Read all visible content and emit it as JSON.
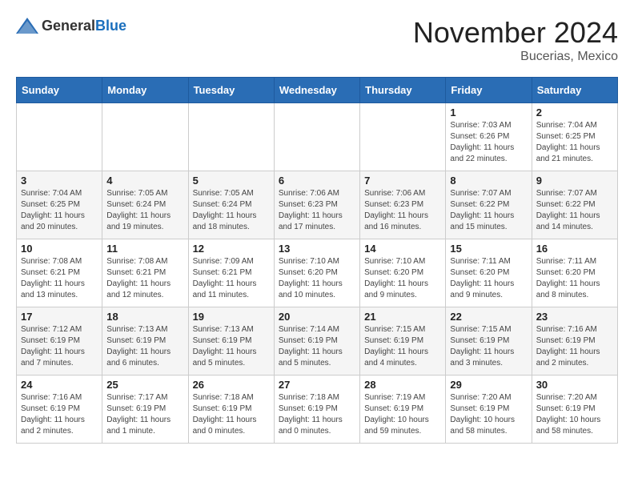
{
  "logo": {
    "text_general": "General",
    "text_blue": "Blue"
  },
  "title": "November 2024",
  "subtitle": "Bucerias, Mexico",
  "days_of_week": [
    "Sunday",
    "Monday",
    "Tuesday",
    "Wednesday",
    "Thursday",
    "Friday",
    "Saturday"
  ],
  "weeks": [
    [
      {
        "day": "",
        "info": ""
      },
      {
        "day": "",
        "info": ""
      },
      {
        "day": "",
        "info": ""
      },
      {
        "day": "",
        "info": ""
      },
      {
        "day": "",
        "info": ""
      },
      {
        "day": "1",
        "info": "Sunrise: 7:03 AM\nSunset: 6:26 PM\nDaylight: 11 hours\nand 22 minutes."
      },
      {
        "day": "2",
        "info": "Sunrise: 7:04 AM\nSunset: 6:25 PM\nDaylight: 11 hours\nand 21 minutes."
      }
    ],
    [
      {
        "day": "3",
        "info": "Sunrise: 7:04 AM\nSunset: 6:25 PM\nDaylight: 11 hours\nand 20 minutes."
      },
      {
        "day": "4",
        "info": "Sunrise: 7:05 AM\nSunset: 6:24 PM\nDaylight: 11 hours\nand 19 minutes."
      },
      {
        "day": "5",
        "info": "Sunrise: 7:05 AM\nSunset: 6:24 PM\nDaylight: 11 hours\nand 18 minutes."
      },
      {
        "day": "6",
        "info": "Sunrise: 7:06 AM\nSunset: 6:23 PM\nDaylight: 11 hours\nand 17 minutes."
      },
      {
        "day": "7",
        "info": "Sunrise: 7:06 AM\nSunset: 6:23 PM\nDaylight: 11 hours\nand 16 minutes."
      },
      {
        "day": "8",
        "info": "Sunrise: 7:07 AM\nSunset: 6:22 PM\nDaylight: 11 hours\nand 15 minutes."
      },
      {
        "day": "9",
        "info": "Sunrise: 7:07 AM\nSunset: 6:22 PM\nDaylight: 11 hours\nand 14 minutes."
      }
    ],
    [
      {
        "day": "10",
        "info": "Sunrise: 7:08 AM\nSunset: 6:21 PM\nDaylight: 11 hours\nand 13 minutes."
      },
      {
        "day": "11",
        "info": "Sunrise: 7:08 AM\nSunset: 6:21 PM\nDaylight: 11 hours\nand 12 minutes."
      },
      {
        "day": "12",
        "info": "Sunrise: 7:09 AM\nSunset: 6:21 PM\nDaylight: 11 hours\nand 11 minutes."
      },
      {
        "day": "13",
        "info": "Sunrise: 7:10 AM\nSunset: 6:20 PM\nDaylight: 11 hours\nand 10 minutes."
      },
      {
        "day": "14",
        "info": "Sunrise: 7:10 AM\nSunset: 6:20 PM\nDaylight: 11 hours\nand 9 minutes."
      },
      {
        "day": "15",
        "info": "Sunrise: 7:11 AM\nSunset: 6:20 PM\nDaylight: 11 hours\nand 9 minutes."
      },
      {
        "day": "16",
        "info": "Sunrise: 7:11 AM\nSunset: 6:20 PM\nDaylight: 11 hours\nand 8 minutes."
      }
    ],
    [
      {
        "day": "17",
        "info": "Sunrise: 7:12 AM\nSunset: 6:19 PM\nDaylight: 11 hours\nand 7 minutes."
      },
      {
        "day": "18",
        "info": "Sunrise: 7:13 AM\nSunset: 6:19 PM\nDaylight: 11 hours\nand 6 minutes."
      },
      {
        "day": "19",
        "info": "Sunrise: 7:13 AM\nSunset: 6:19 PM\nDaylight: 11 hours\nand 5 minutes."
      },
      {
        "day": "20",
        "info": "Sunrise: 7:14 AM\nSunset: 6:19 PM\nDaylight: 11 hours\nand 5 minutes."
      },
      {
        "day": "21",
        "info": "Sunrise: 7:15 AM\nSunset: 6:19 PM\nDaylight: 11 hours\nand 4 minutes."
      },
      {
        "day": "22",
        "info": "Sunrise: 7:15 AM\nSunset: 6:19 PM\nDaylight: 11 hours\nand 3 minutes."
      },
      {
        "day": "23",
        "info": "Sunrise: 7:16 AM\nSunset: 6:19 PM\nDaylight: 11 hours\nand 2 minutes."
      }
    ],
    [
      {
        "day": "24",
        "info": "Sunrise: 7:16 AM\nSunset: 6:19 PM\nDaylight: 11 hours\nand 2 minutes."
      },
      {
        "day": "25",
        "info": "Sunrise: 7:17 AM\nSunset: 6:19 PM\nDaylight: 11 hours\nand 1 minute."
      },
      {
        "day": "26",
        "info": "Sunrise: 7:18 AM\nSunset: 6:19 PM\nDaylight: 11 hours\nand 0 minutes."
      },
      {
        "day": "27",
        "info": "Sunrise: 7:18 AM\nSunset: 6:19 PM\nDaylight: 11 hours\nand 0 minutes."
      },
      {
        "day": "28",
        "info": "Sunrise: 7:19 AM\nSunset: 6:19 PM\nDaylight: 10 hours\nand 59 minutes."
      },
      {
        "day": "29",
        "info": "Sunrise: 7:20 AM\nSunset: 6:19 PM\nDaylight: 10 hours\nand 58 minutes."
      },
      {
        "day": "30",
        "info": "Sunrise: 7:20 AM\nSunset: 6:19 PM\nDaylight: 10 hours\nand 58 minutes."
      }
    ]
  ]
}
